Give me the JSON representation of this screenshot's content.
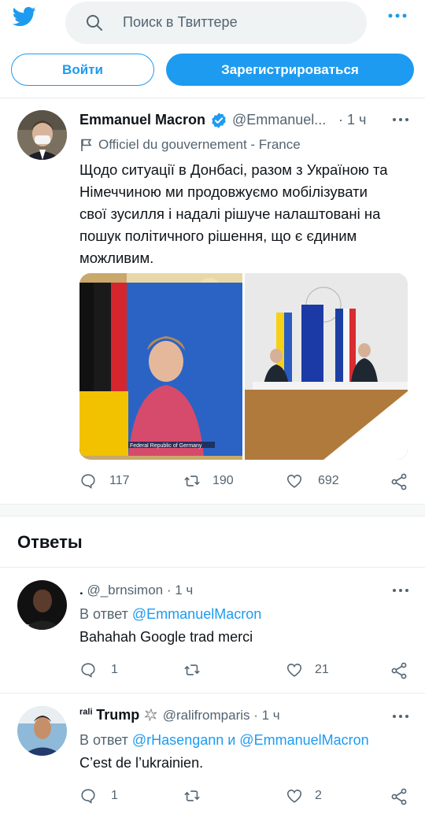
{
  "header": {
    "search_placeholder": "Поиск в Твиттере",
    "login_label": "Войти",
    "signup_label": "Зарегистрироваться"
  },
  "tweet": {
    "author_name": "Emmanuel Macron",
    "handle": "@Emmanuel...",
    "time": "· 1 ч",
    "label": "Officiel du gouvernement - France",
    "text_lines": [
      "Щодо ситуації в Донбасі, разом з Україною та",
      "Німеччиною ми продовжуємо мобілізувати",
      "свої зусилля і надалі рішуче налаштовані на",
      "пошук політичного рішення, що є єдиним",
      "можливим."
    ],
    "image_caption": "Federal Republic of Germany",
    "replies": "117",
    "retweets": "190",
    "likes": "692"
  },
  "replies_section": {
    "title": "Ответы"
  },
  "replies": [
    {
      "name": ".",
      "handle": "@_brnsimon",
      "time": "· 1 ч",
      "in_reply_prefix": "В ответ",
      "mentions": "@EmmanuelMacron",
      "text": "Bahahah Google trad merci",
      "replies": "1",
      "retweets": "",
      "likes": "21"
    },
    {
      "name_prefix": "rali",
      "name": "Trump",
      "handle": "@ralifromparis",
      "time": "· 1 ч",
      "in_reply_prefix": "В ответ",
      "mentions": "@rHasengann и @EmmanuelMacron",
      "text": "C’est de l’ukrainien.",
      "replies": "1",
      "retweets": "",
      "likes": "2"
    }
  ],
  "colors": {
    "accent": "#1d9bf0",
    "text": "#0f1419",
    "secondary": "#536471",
    "border": "#e6ecf0"
  },
  "icons": [
    "twitter-logo-icon",
    "search-icon",
    "more-icon",
    "verified-icon",
    "flag-icon",
    "reply-icon",
    "retweet-icon",
    "like-icon",
    "share-icon"
  ]
}
